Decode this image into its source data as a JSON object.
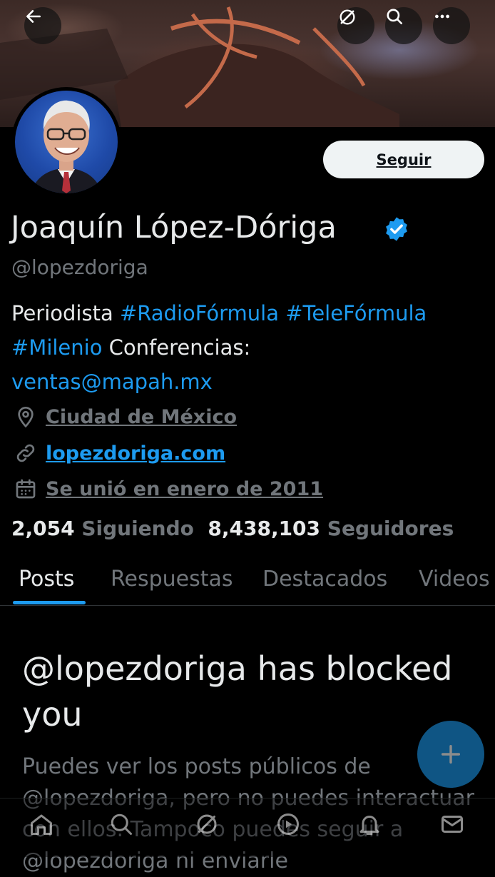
{
  "profile": {
    "name": "Joaquín López-Dóriga",
    "handle": "@lopezdoriga",
    "follow_label": "Seguir",
    "bio_parts": {
      "p1": "Periodista ",
      "tag1": "#RadioFórmula",
      "space1": " ",
      "tag2": "#TeleFórmula",
      "tag3": "#Milenio",
      "p2": " Conferencias:",
      "email": "ventas@mapah.mx"
    },
    "location": "Ciudad de México",
    "website": "lopezdoriga.com",
    "joined": "Se unió en enero de 2011",
    "following_count": "2,054",
    "following_label": "Siguiendo",
    "followers_count": "8,438,103",
    "followers_label": "Seguidores"
  },
  "tabs": [
    "Posts",
    "Respuestas",
    "Destacados",
    "Videos"
  ],
  "blocked": {
    "title": "@lopezdoriga has blocked you",
    "body": "Puedes ver los posts públicos de @lopezdoriga, pero no puedes interactuar con ellos. Tampoco puedes seguir a @lopezdoriga ni enviarle"
  },
  "colors": {
    "accent": "#1d9bf0",
    "background": "#000000",
    "text_primary": "#e7e9ea",
    "text_secondary": "#71767b"
  },
  "icons": {
    "back": "arrow-left-icon",
    "grok": "grok-icon",
    "search": "search-icon",
    "more": "more-icon",
    "verified": "verified-badge-icon",
    "location": "location-pin-icon",
    "link": "link-icon",
    "calendar": "calendar-icon",
    "compose": "plus-icon",
    "nav": [
      "home-icon",
      "search-icon",
      "grok-icon",
      "spaces-icon",
      "notifications-icon",
      "messages-icon"
    ]
  }
}
